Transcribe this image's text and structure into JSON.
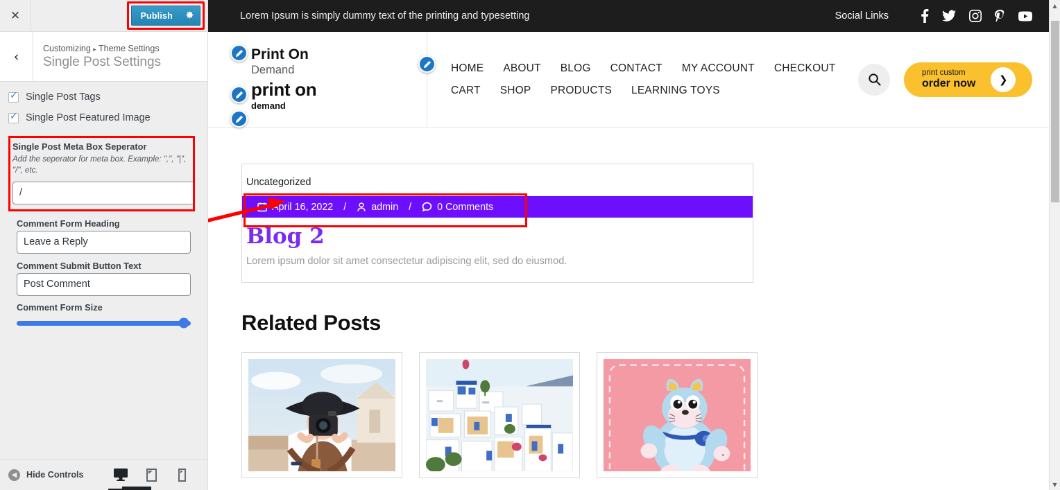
{
  "customizer": {
    "close_icon": "close-icon",
    "publish_label": "Publish",
    "publish_gear_icon": "gear-icon",
    "back_icon": "chevron-left-icon",
    "breadcrumb_root": "Customizing",
    "breadcrumb_sep": "▸",
    "breadcrumb_parent": "Theme Settings",
    "panel_title": "Single Post Settings",
    "controls": {
      "single_post_tags": {
        "label": "Single Post Tags",
        "checked": true
      },
      "single_post_featured_image": {
        "label": "Single Post Featured Image",
        "checked": true
      },
      "meta_box_separator": {
        "label": "Single Post Meta Box Seperator",
        "description": "Add the seperator for meta box. Example: \",\", \"|\", \"/\", etc.",
        "value": "/"
      },
      "comment_form_heading": {
        "label": "Comment Form Heading",
        "value": "Leave a Reply"
      },
      "comment_submit_button": {
        "label": "Comment Submit Button Text",
        "value": "Post Comment"
      },
      "comment_form_size": {
        "label": "Comment Form Size",
        "percent": 96
      }
    },
    "footer": {
      "hide_controls_label": "Hide Controls",
      "devices": [
        {
          "name": "desktop",
          "active": true
        },
        {
          "name": "tablet",
          "active": false
        },
        {
          "name": "mobile",
          "active": false
        }
      ]
    },
    "highlight_color": "#fe0000"
  },
  "preview": {
    "topbar": {
      "message": "Lorem Ipsum is simply dummy text of the printing and typesetting",
      "social_label": "Social Links",
      "social_icons": [
        "facebook-icon",
        "twitter-icon",
        "instagram-icon",
        "pinterest-icon",
        "youtube-icon"
      ],
      "background": "#1d1d1d"
    },
    "logo": {
      "line1": "Print On",
      "line2": "Demand",
      "line3": "print on",
      "line4": "demand"
    },
    "nav_items": [
      "HOME",
      "ABOUT",
      "BLOG",
      "CONTACT",
      "MY ACCOUNT",
      "CHECKOUT",
      "CART",
      "SHOP",
      "PRODUCTS",
      "LEARNING TOYS"
    ],
    "search_icon": "search-icon",
    "cta": {
      "small": "print custom",
      "large": "order now",
      "arrow_icon": "chevron-right-icon",
      "color": "#fac02e"
    },
    "post": {
      "category": "Uncategorized",
      "meta": {
        "date": "April 16, 2022",
        "date_icon": "calendar-icon",
        "author": "admin",
        "author_icon": "user-icon",
        "comments": "0 Comments",
        "comments_icon": "comment-icon",
        "separator": "/",
        "bar_color": "#6d0ffd"
      },
      "title": "Blog 2",
      "title_color": "#7a2df0",
      "excerpt": "Lorem ipsum dolor sit amet consectetur adipiscing elit, sed do eiusmod."
    },
    "related": {
      "heading": "Related Posts",
      "items": [
        {
          "name": "woman-photographer-hat-photo"
        },
        {
          "name": "santorini-white-blue-village-photo"
        },
        {
          "name": "blue-plush-toy-pink-background-photo"
        }
      ]
    }
  }
}
